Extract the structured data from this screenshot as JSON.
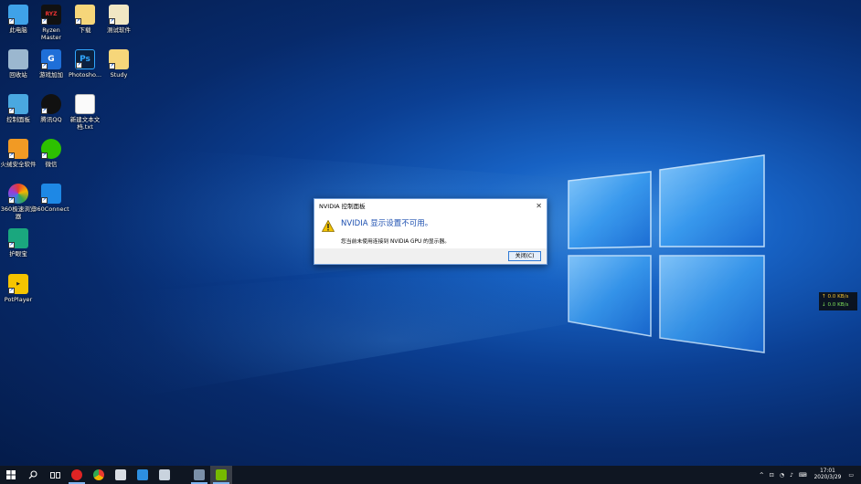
{
  "colors": {
    "accent": "#0078d7",
    "dialog_text": "#1c4fb0",
    "taskbar": "#0f1622"
  },
  "desktop_icons": [
    {
      "label": "此电脑",
      "icon": "computer-icon"
    },
    {
      "label": "Ryzen Master",
      "icon": "ryzen-master-icon"
    },
    {
      "label": "下载",
      "icon": "folder-icon"
    },
    {
      "label": "测试软件",
      "icon": "folder-icon"
    },
    {
      "label": "回收站",
      "icon": "recycle-bin-icon"
    },
    {
      "label": "游戏加加",
      "icon": "game-plus-icon"
    },
    {
      "label": "Photosho...",
      "icon": "photoshop-icon"
    },
    {
      "label": "Study",
      "icon": "folder-icon"
    },
    {
      "label": "控制面板",
      "icon": "control-panel-icon"
    },
    {
      "label": "腾讯QQ",
      "icon": "qq-icon"
    },
    {
      "label": "新建文本文档.txt",
      "icon": "text-file-icon"
    },
    {
      "label": "火绒安全软件",
      "icon": "huorong-icon"
    },
    {
      "label": "微信",
      "icon": "wechat-icon"
    },
    {
      "label": "360极速浏览器",
      "icon": "360-browser-icon"
    },
    {
      "label": "360Connect",
      "icon": "360-connect-icon"
    },
    {
      "label": "护眼宝",
      "icon": "eye-care-icon"
    },
    {
      "label": "PotPlayer",
      "icon": "potplayer-icon"
    }
  ],
  "dialog": {
    "title": "NVIDIA 控制面板",
    "close_glyph": "✕",
    "message": "NVIDIA 显示设置不可用。",
    "detail": "您当前未使用连接到 NVIDIA GPU 的显示器。",
    "button": "关闭(C)"
  },
  "netspeed": {
    "up": "↑ 0.0 KB/s",
    "down": "↓ 0.0 KB/s"
  },
  "taskbar": {
    "apps": [
      "start-icon",
      "search-icon",
      "task-view-icon",
      "netease-music-icon",
      "chrome-icon",
      "terminal-icon",
      "app-icon",
      "text-editor-icon",
      "nvidia-icon-a",
      "nvidia-control-panel-icon"
    ],
    "tray": {
      "chevron": "^",
      "time": "17:01",
      "date": "2020/3/29"
    }
  }
}
